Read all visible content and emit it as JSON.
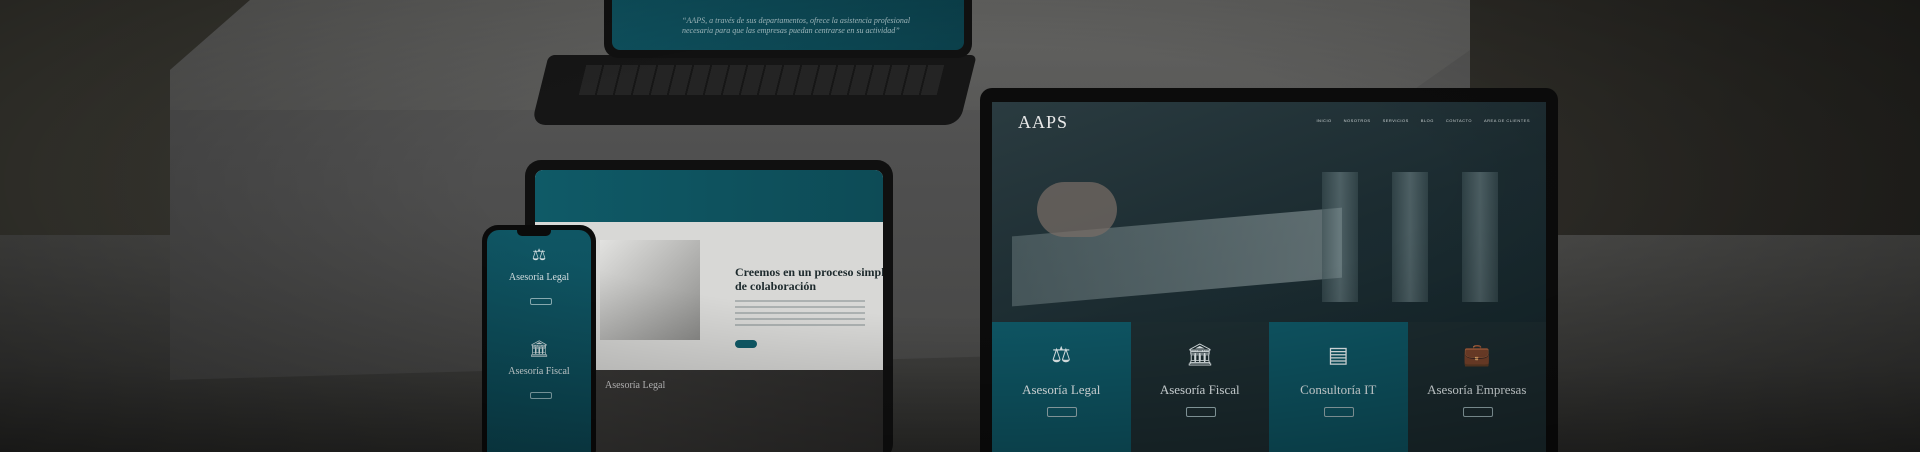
{
  "colors": {
    "teal": "#0f5a67",
    "dark_teal": "#0c4855",
    "background": "#1f1e1b"
  },
  "laptop": {
    "logo": "AAPS",
    "nav": [
      "INICIO",
      "NOSOTROS",
      "SERVICIOS",
      "BLOG",
      "CONTACTO",
      "AREA DE CLIENTES"
    ],
    "cards": [
      {
        "label": "Asesoría Legal",
        "icon": "scales-icon"
      },
      {
        "label": "Asesoría Fiscal",
        "icon": "bank-icon"
      },
      {
        "label": "Consultoría IT",
        "icon": "document-icon"
      },
      {
        "label": "Asesoría Empresas",
        "icon": "briefcase-icon"
      }
    ]
  },
  "tablet_top": {
    "quote": "“AAPS, a través de sus departamentos, ofrece la asistencia profesional necesaria para que las empresas puedan centrarse en su actividad”"
  },
  "tablet_mid": {
    "heading": "Creemos en un proceso simple de colaboración",
    "lower_label": "Asesoría Legal"
  },
  "phone": {
    "items": [
      {
        "label": "Asesoría Legal",
        "icon": "scales-icon"
      },
      {
        "label": "Asesoría Fiscal",
        "icon": "bank-icon"
      }
    ]
  }
}
